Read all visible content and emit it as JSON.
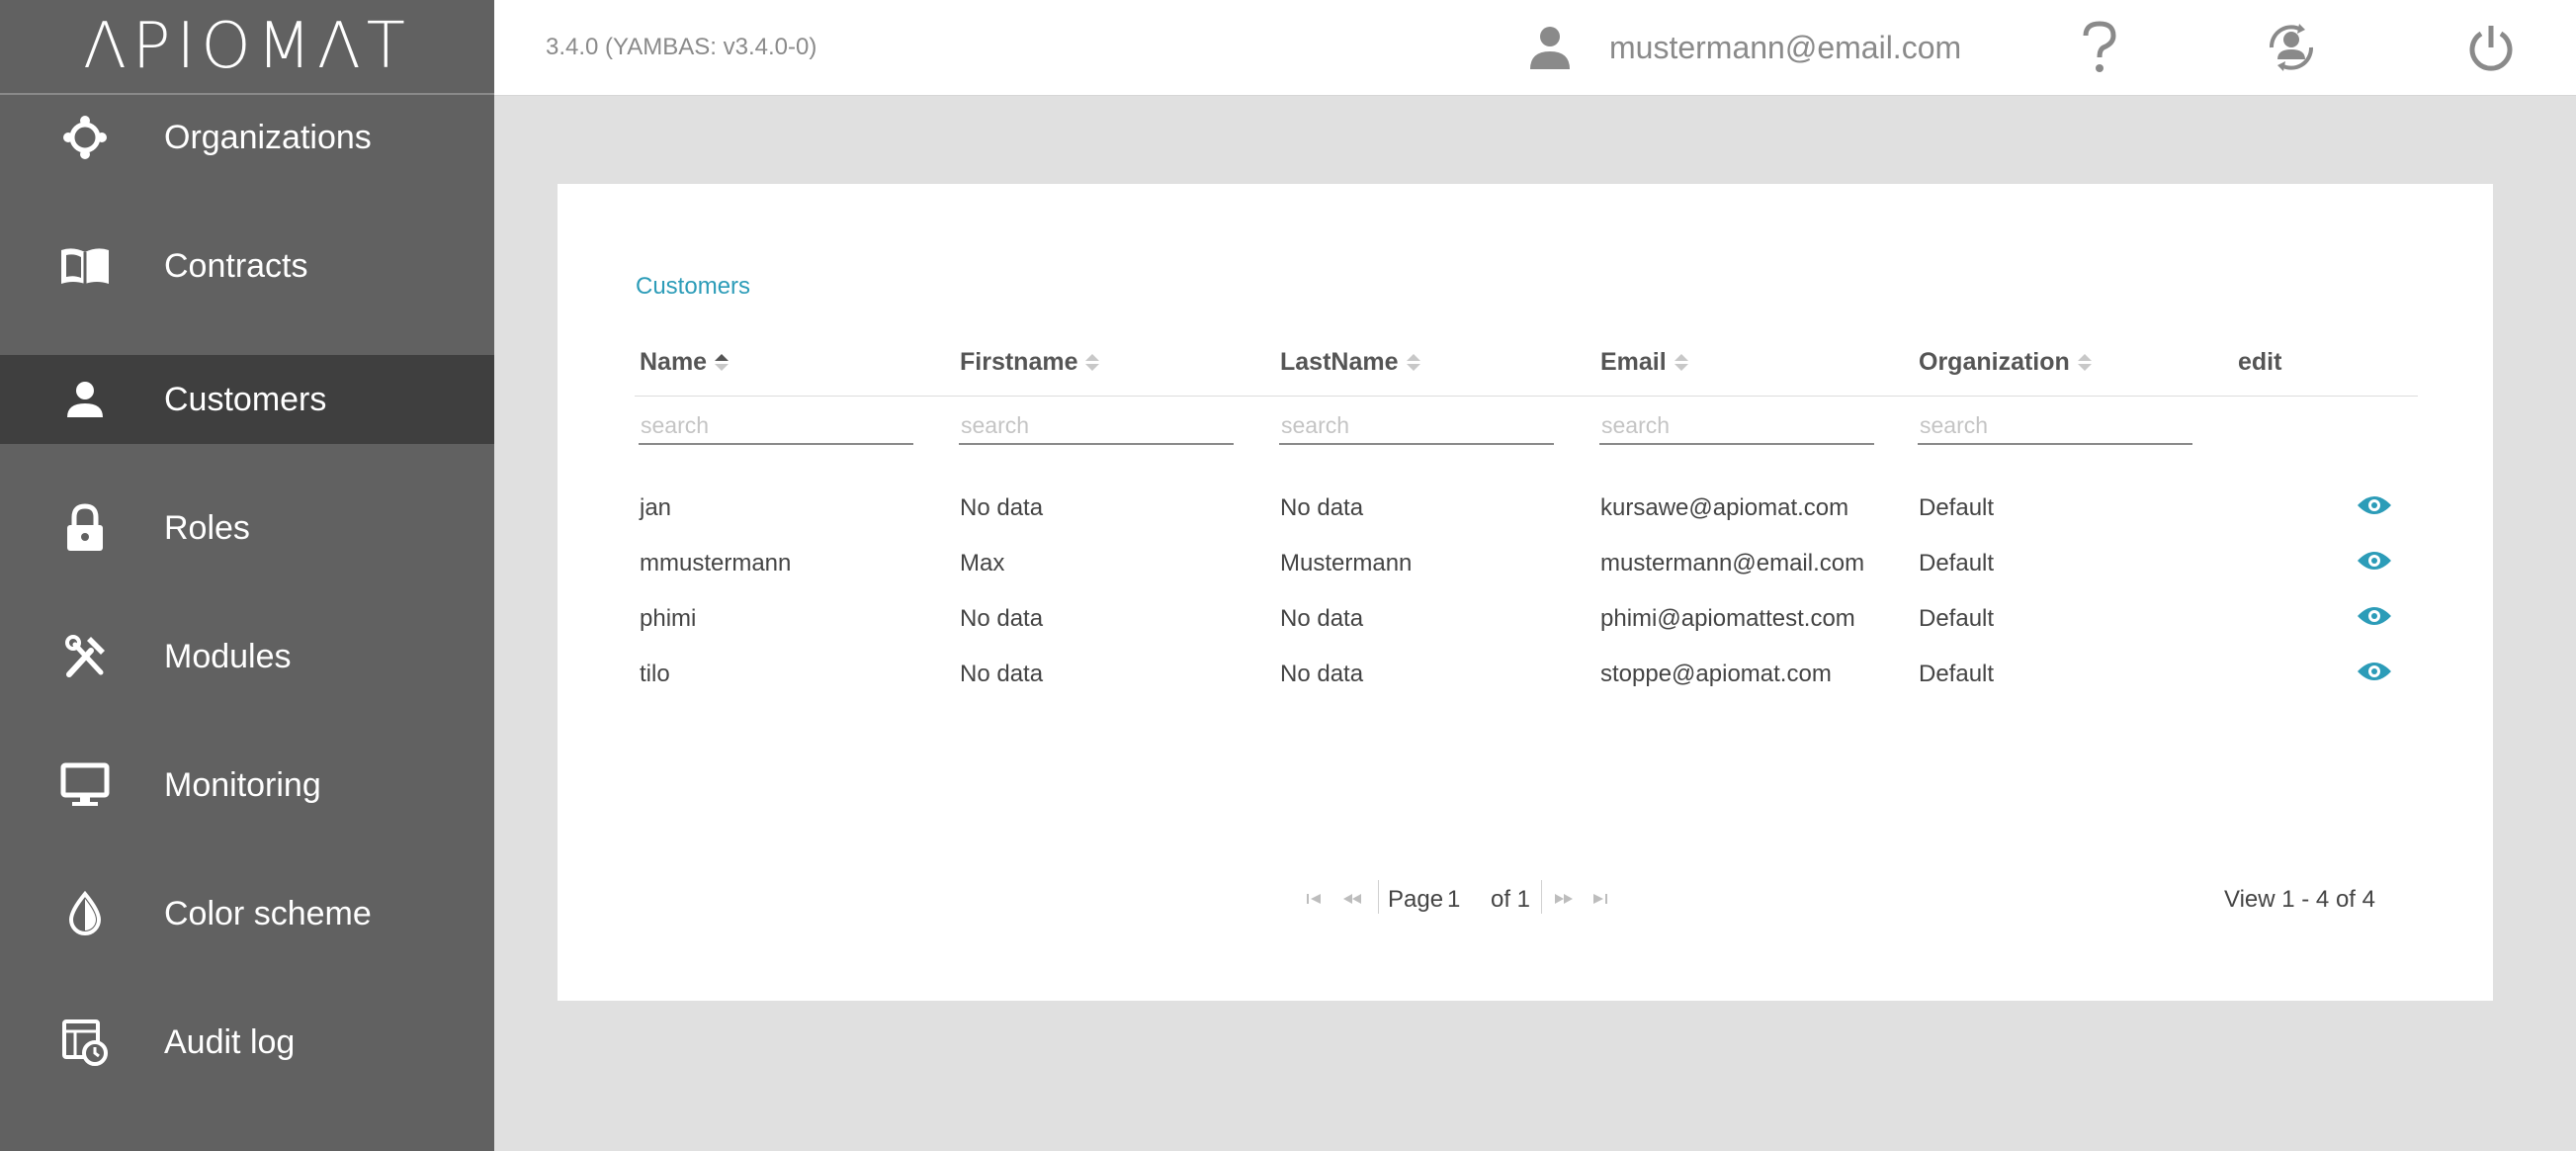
{
  "logo": "ΛPIOMΛT",
  "header": {
    "version": "3.4.0 (YAMBAS: v3.4.0-0)",
    "user_email": "mustermann@email.com",
    "icons": [
      "user-icon",
      "help-icon",
      "switch-account-icon",
      "power-icon"
    ]
  },
  "sidebar": {
    "items": [
      {
        "label": "Organizations",
        "icon": "organizations-icon"
      },
      {
        "label": "Contracts",
        "icon": "book-icon"
      },
      {
        "label": "Customers",
        "icon": "person-icon",
        "active": true
      },
      {
        "label": "Roles",
        "icon": "lock-icon"
      },
      {
        "label": "Modules",
        "icon": "tools-icon"
      },
      {
        "label": "Monitoring",
        "icon": "monitor-icon"
      },
      {
        "label": "Color scheme",
        "icon": "drop-icon"
      },
      {
        "label": "Audit log",
        "icon": "audit-log-icon"
      }
    ]
  },
  "main": {
    "title": "Customers",
    "columns": [
      {
        "label": "Name",
        "sorted": "asc"
      },
      {
        "label": "Firstname"
      },
      {
        "label": "LastName"
      },
      {
        "label": "Email"
      },
      {
        "label": "Organization"
      },
      {
        "label": "edit"
      }
    ],
    "search_placeholder": "search",
    "rows": [
      {
        "name": "jan",
        "firstname": "No data",
        "lastname": "No data",
        "email": "kursawe@apiomat.com",
        "organization": "Default"
      },
      {
        "name": "mmustermann",
        "firstname": "Max",
        "lastname": "Mustermann",
        "email": "mustermann@email.com",
        "organization": "Default"
      },
      {
        "name": "phimi",
        "firstname": "No data",
        "lastname": "No data",
        "email": "phimi@apiomattest.com",
        "organization": "Default"
      },
      {
        "name": "tilo",
        "firstname": "No data",
        "lastname": "No data",
        "email": "stoppe@apiomat.com",
        "organization": "Default"
      }
    ],
    "pager": {
      "page_label": "Page",
      "page": "1",
      "of_label": "of 1",
      "view_text": "View 1 - 4 of 4"
    }
  },
  "colors": {
    "sidebar_bg": "#616161",
    "sidebar_active": "#3f3f3f",
    "accent": "#2c9cb8",
    "page_bg": "#e0e0e0"
  }
}
